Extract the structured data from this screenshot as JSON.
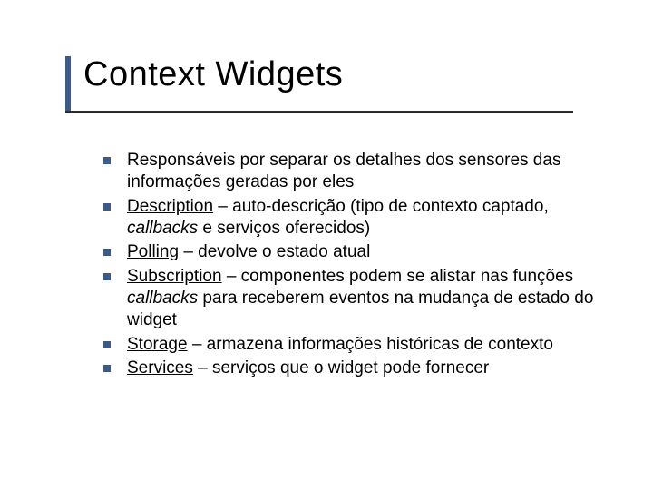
{
  "title": "Context Widgets",
  "bullets": [
    {
      "pre": "",
      "term": "",
      "post": "Responsáveis por separar os detalhes dos sensores das informações geradas por eles",
      "italic1": "",
      "tail": ""
    },
    {
      "pre": "",
      "term": "Description",
      "post": " – auto-descrição (tipo de contexto captado, ",
      "italic1": "callbacks",
      "tail": " e serviços oferecidos)"
    },
    {
      "pre": "",
      "term": "Polling",
      "post": " – devolve o estado atual",
      "italic1": "",
      "tail": ""
    },
    {
      "pre": "",
      "term": "Subscription",
      "post": " – componentes podem se alistar nas funções ",
      "italic1": "callbacks",
      "tail": "  para receberem eventos na mudança de estado do widget"
    },
    {
      "pre": "",
      "term": "Storage",
      "post": " – armazena informações históricas de contexto",
      "italic1": "",
      "tail": ""
    },
    {
      "pre": "",
      "term": "Services",
      "post": " – serviços que o widget pode fornecer",
      "italic1": "",
      "tail": ""
    }
  ]
}
